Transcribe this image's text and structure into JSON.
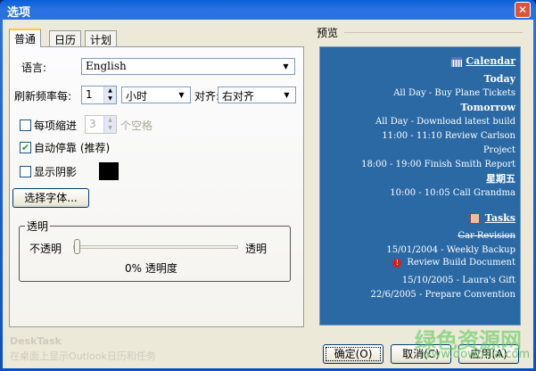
{
  "window": {
    "title": "选项",
    "close": "✕"
  },
  "tabs": [
    "普通",
    "日历",
    "计划"
  ],
  "general": {
    "language_label": "语言:",
    "language_value": "English",
    "refresh_label": "刷新频率每:",
    "refresh_value": "1",
    "refresh_unit": "小时",
    "align_label": "对齐:",
    "align_value": "右对齐",
    "indent_label": "每项缩进",
    "indent_value": "3",
    "indent_unit": "个空格",
    "autodock_label": "自动停靠 (推荐)",
    "shadow_label": "显示阴影",
    "shadow_color": "#000000",
    "font_button": "选择字体...",
    "transparency": {
      "legend": "透明",
      "left": "不透明",
      "right": "透明",
      "value_percent": 0,
      "readout": "0% 透明度"
    }
  },
  "preview": {
    "label": "预览",
    "calendar_title": "Calendar",
    "calendar": [
      {
        "type": "h",
        "text": "Today"
      },
      {
        "type": "i",
        "text": "All Day - Buy Plane Tickets"
      },
      {
        "type": "h",
        "text": "Tomorrow"
      },
      {
        "type": "i",
        "text": "All Day - Download latest build"
      },
      {
        "type": "i",
        "text": "11:00 - 11:10 Review Carlson"
      },
      {
        "type": "i",
        "text": "Project"
      },
      {
        "type": "i",
        "text": "18:00 - 19:00 Finish Smith Report"
      },
      {
        "type": "h",
        "text": "星期五"
      },
      {
        "type": "i",
        "text": "10:00 - 10:05 Call Grandma"
      }
    ],
    "tasks_title": "Tasks",
    "tasks": [
      "Car Revision",
      "15/01/2004 - Weekly Backup",
      "Review Build Document",
      "15/10/2005 - Laura's Gift",
      "22/6/2005 - Prepare Convention"
    ]
  },
  "footer": {
    "app_name": "DeskTask",
    "app_desc": "在桌面上显示Outlook日历和任务",
    "watermark": "绿色资源网",
    "watermark_url": "www.downxia.com"
  },
  "buttons": {
    "ok": "确定(O)",
    "cancel": "取消(C)",
    "apply": "应用(A)"
  }
}
